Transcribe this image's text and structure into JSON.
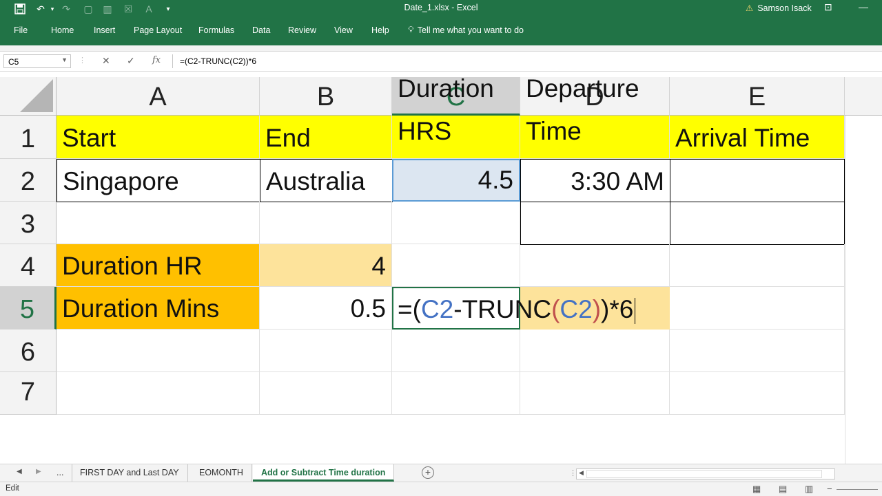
{
  "window": {
    "title": "Date_1.xlsx  -  Excel",
    "user": "Samson Isack"
  },
  "ribbon": {
    "tabs": [
      "File",
      "Home",
      "Insert",
      "Page Layout",
      "Formulas",
      "Data",
      "Review",
      "View",
      "Help"
    ],
    "tell_me": "Tell me what you want to do"
  },
  "formula_bar": {
    "name_box": "C5",
    "formula": "=(C2-TRUNC(C2))*6",
    "fx": "fx"
  },
  "columns": [
    "A",
    "B",
    "C",
    "D",
    "E"
  ],
  "rows": [
    "1",
    "2",
    "3",
    "4",
    "5",
    "6",
    "7"
  ],
  "cells": {
    "A1": "Start",
    "B1": "End",
    "C1_line1": "Duration",
    "C1_line2": "HRS",
    "D1_line1": "Departure",
    "D1_line2": "Time",
    "E1": "Arrival Time",
    "A2": "Singapore",
    "B2": "Australia",
    "C2": "4.5",
    "D2": "3:30 AM",
    "A4": "Duration HR",
    "B4": "4",
    "A5": "Duration Mins",
    "B5": "0.5",
    "C5_edit": {
      "p1": "=(",
      "ref1": "C2",
      "p2": "-TRUNC",
      "paren_open": "(",
      "ref2": "C2",
      "paren_close": ")",
      "p3": ")*6"
    }
  },
  "sheets": {
    "tabs": [
      "FIRST DAY and Last DAY",
      "EOMONTH",
      "Add or Subtract Time duration"
    ],
    "active": "Add or Subtract Time duration",
    "more": "..."
  },
  "status": {
    "mode": "Edit"
  },
  "colors": {
    "excel_green": "#217346",
    "yellow": "#ffff00",
    "orange": "#ffc000",
    "light_orange": "#fde39b",
    "ref_blue": "#4472c4",
    "ref_red": "#c0504d"
  }
}
